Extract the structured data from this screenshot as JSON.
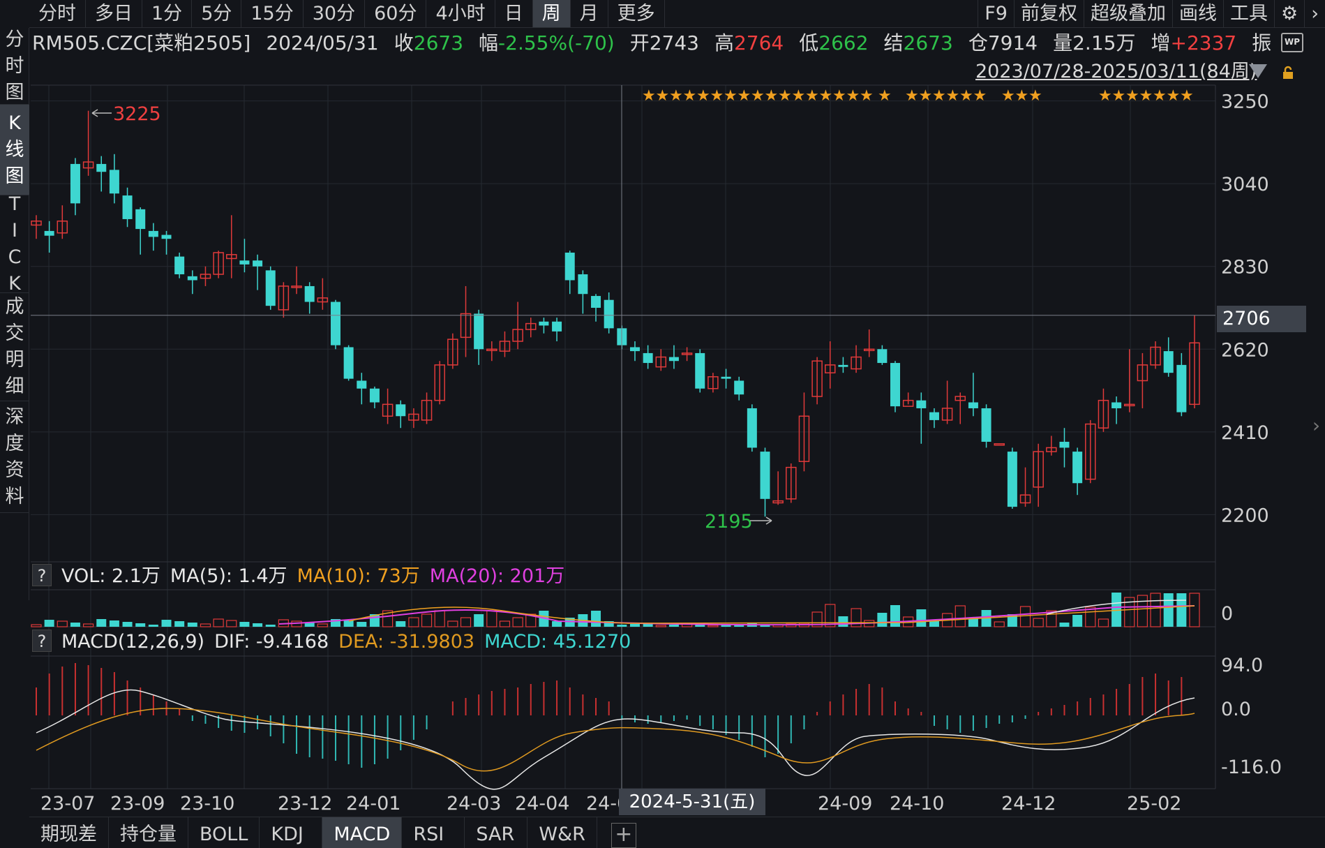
{
  "period_tabs": [
    "分时",
    "多日",
    "1分",
    "5分",
    "15分",
    "30分",
    "60分",
    "4小时",
    "日",
    "周",
    "月",
    "更多"
  ],
  "active_period": "周",
  "right_tools": [
    "F9",
    "前复权",
    "超级叠加",
    "画线",
    "工具"
  ],
  "left_tabs": [
    {
      "chars": [
        "分",
        "时",
        "图"
      ]
    },
    {
      "chars": [
        "K",
        "线",
        "图"
      ]
    },
    {
      "chars": [
        "T",
        "I",
        "C",
        "K"
      ]
    },
    {
      "chars": [
        "成",
        "交",
        "明",
        "细"
      ]
    },
    {
      "chars": [
        "深",
        "度",
        "资",
        "料"
      ]
    }
  ],
  "info": {
    "symbol": "RM505.CZC[菜粕2505]",
    "date": "2024/05/31",
    "close_label": "收",
    "close": "2673",
    "change_label": "幅",
    "change": "-2.55%(-70)",
    "open_label": "开",
    "open": "2743",
    "high_label": "高",
    "high": "2764",
    "low_label": "低",
    "low": "2662",
    "settle_label": "结",
    "settle": "2673",
    "oi_label": "仓",
    "oi": "7914",
    "vol_label": "量",
    "vol": "2.15万",
    "inc_label": "增",
    "inc": "+2337",
    "amp_label": "振"
  },
  "range_text": "2023/07/28-2025/03/11(84周)",
  "wp_icon": "WP",
  "crosshair": {
    "price": "2706",
    "date": "2024-5-31(五)"
  },
  "price_axis": [
    "3250",
    "3040",
    "2830",
    "2620",
    "2410",
    "2200"
  ],
  "vol_axis": [
    "0"
  ],
  "macd_axis": [
    "94.0",
    "0.0",
    "-116.0"
  ],
  "max_label": "3225",
  "min_label": "2195",
  "vol_indicator": {
    "q": "?",
    "vol": "VOL: 2.1万",
    "ma5": "MA(5): 1.4万",
    "ma10": "MA(10): 73万",
    "ma20": "MA(20): 201万"
  },
  "macd_indicator": {
    "q": "?",
    "name": "MACD(12,26,9)",
    "dif": "DIF: -9.4168",
    "dea": "DEA: -31.9803",
    "macd": "MACD: 45.1270"
  },
  "x_labels": [
    "23-07",
    "23-09",
    "23-10",
    "23-12",
    "24-01",
    "24-03",
    "24-04",
    "24-0",
    "24-09",
    "24-10",
    "24-12",
    "25-02"
  ],
  "bottom_tabs": [
    "期现差",
    "持仓量",
    "BOLL",
    "KDJ",
    "MACD",
    "RSI",
    "SAR",
    "W&R"
  ],
  "active_bottom": "MACD",
  "add_tab": "+",
  "colors": {
    "up": "#e03a3a",
    "down": "#3ed6d0",
    "bg": "#13151a",
    "grid": "#262a31",
    "dif": "#e8e8e8",
    "dea": "#e09a20",
    "ma10": "#f0a020",
    "ma20": "#e040e0"
  },
  "chart_data": {
    "type": "candlestick",
    "title": "RM505.CZC[菜粕2505]",
    "ylim": [
      2160,
      3290
    ],
    "candles": [
      [
        2935,
        2945,
        2900,
        2960
      ],
      [
        2920,
        2908,
        2865,
        2945
      ],
      [
        2915,
        2945,
        2900,
        2985
      ],
      [
        3090,
        2990,
        2960,
        3105
      ],
      [
        3080,
        3095,
        3060,
        3225
      ],
      [
        3090,
        3070,
        3020,
        3110
      ],
      [
        3075,
        3015,
        2990,
        3115
      ],
      [
        3010,
        2950,
        2930,
        3030
      ],
      [
        2975,
        2925,
        2860,
        2980
      ],
      [
        2920,
        2905,
        2870,
        2940
      ],
      [
        2910,
        2900,
        2860,
        2920
      ],
      [
        2855,
        2810,
        2800,
        2865
      ],
      [
        2805,
        2795,
        2760,
        2820
      ],
      [
        2800,
        2810,
        2780,
        2830
      ],
      [
        2810,
        2865,
        2800,
        2870
      ],
      [
        2850,
        2860,
        2800,
        2960
      ],
      [
        2845,
        2835,
        2815,
        2900
      ],
      [
        2845,
        2830,
        2770,
        2860
      ],
      [
        2820,
        2730,
        2720,
        2830
      ],
      [
        2720,
        2780,
        2700,
        2790
      ],
      [
        2780,
        2780,
        2760,
        2830
      ],
      [
        2780,
        2740,
        2710,
        2790
      ],
      [
        2740,
        2750,
        2720,
        2800
      ],
      [
        2740,
        2630,
        2620,
        2745
      ],
      [
        2625,
        2545,
        2540,
        2630
      ],
      [
        2540,
        2520,
        2480,
        2560
      ],
      [
        2520,
        2485,
        2470,
        2525
      ],
      [
        2450,
        2480,
        2430,
        2520
      ],
      [
        2480,
        2450,
        2420,
        2490
      ],
      [
        2440,
        2455,
        2420,
        2470
      ],
      [
        2440,
        2490,
        2430,
        2510
      ],
      [
        2490,
        2580,
        2480,
        2590
      ],
      [
        2580,
        2645,
        2570,
        2660
      ],
      [
        2650,
        2710,
        2600,
        2780
      ],
      [
        2710,
        2620,
        2580,
        2720
      ],
      [
        2620,
        2620,
        2590,
        2640
      ],
      [
        2615,
        2640,
        2600,
        2665
      ],
      [
        2640,
        2670,
        2620,
        2740
      ],
      [
        2670,
        2685,
        2650,
        2700
      ],
      [
        2690,
        2680,
        2660,
        2700
      ],
      [
        2690,
        2665,
        2640,
        2700
      ],
      [
        2865,
        2795,
        2760,
        2870
      ],
      [
        2810,
        2760,
        2710,
        2820
      ],
      [
        2755,
        2725,
        2690,
        2760
      ],
      [
        2745,
        2673,
        2660,
        2764
      ],
      [
        2673,
        2630,
        2620,
        2680
      ],
      [
        2625,
        2615,
        2590,
        2640
      ],
      [
        2610,
        2585,
        2570,
        2630
      ],
      [
        2575,
        2600,
        2565,
        2620
      ],
      [
        2600,
        2590,
        2570,
        2630
      ],
      [
        2610,
        2610,
        2590,
        2625
      ],
      [
        2610,
        2520,
        2510,
        2620
      ],
      [
        2520,
        2550,
        2510,
        2560
      ],
      [
        2550,
        2545,
        2520,
        2570
      ],
      [
        2540,
        2505,
        2490,
        2550
      ],
      [
        2470,
        2370,
        2360,
        2480
      ],
      [
        2360,
        2240,
        2195,
        2370
      ],
      [
        2230,
        2235,
        2225,
        2310
      ],
      [
        2240,
        2320,
        2230,
        2330
      ],
      [
        2335,
        2450,
        2310,
        2510
      ],
      [
        2500,
        2590,
        2480,
        2600
      ],
      [
        2560,
        2580,
        2520,
        2640
      ],
      [
        2580,
        2575,
        2560,
        2600
      ],
      [
        2570,
        2600,
        2560,
        2630
      ],
      [
        2620,
        2620,
        2600,
        2670
      ],
      [
        2620,
        2585,
        2580,
        2630
      ],
      [
        2585,
        2475,
        2460,
        2590
      ],
      [
        2475,
        2490,
        2480,
        2510
      ],
      [
        2490,
        2470,
        2380,
        2510
      ],
      [
        2460,
        2440,
        2420,
        2470
      ],
      [
        2440,
        2470,
        2430,
        2540
      ],
      [
        2490,
        2500,
        2430,
        2510
      ],
      [
        2485,
        2470,
        2450,
        2560
      ],
      [
        2470,
        2385,
        2370,
        2480
      ],
      [
        2380,
        2380,
        2380,
        2380
      ],
      [
        2360,
        2220,
        2215,
        2370
      ],
      [
        2230,
        2250,
        2220,
        2320
      ],
      [
        2270,
        2360,
        2220,
        2380
      ],
      [
        2360,
        2370,
        2350,
        2400
      ],
      [
        2385,
        2370,
        2320,
        2420
      ],
      [
        2360,
        2280,
        2250,
        2370
      ],
      [
        2290,
        2430,
        2280,
        2440
      ],
      [
        2420,
        2490,
        2410,
        2520
      ],
      [
        2485,
        2470,
        2430,
        2500
      ],
      [
        2480,
        2480,
        2460,
        2620
      ],
      [
        2540,
        2580,
        2470,
        2610
      ],
      [
        2580,
        2625,
        2570,
        2640
      ],
      [
        2615,
        2560,
        2550,
        2650
      ],
      [
        2580,
        2460,
        2450,
        2610
      ],
      [
        2480,
        2636,
        2470,
        2706
      ]
    ]
  }
}
